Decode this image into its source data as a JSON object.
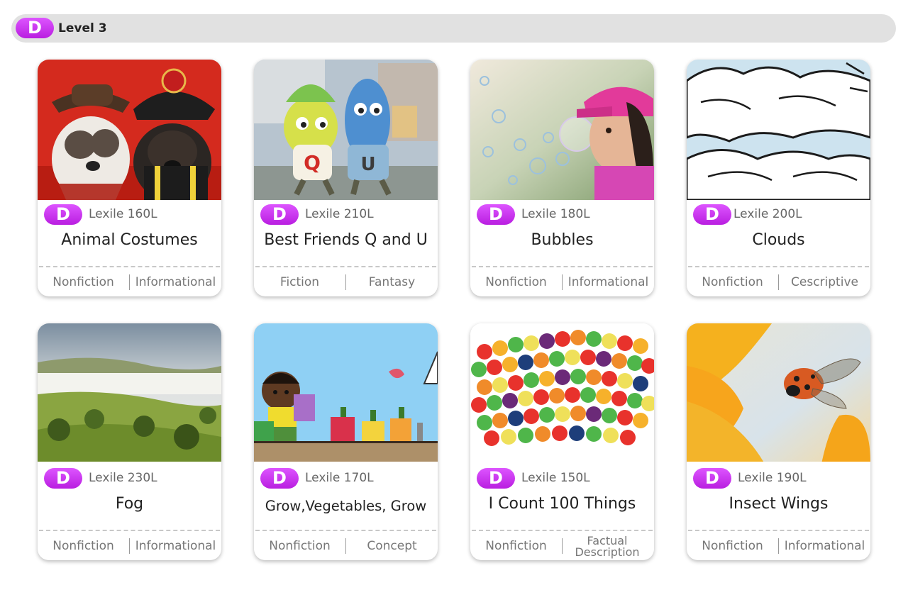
{
  "header": {
    "badge": "D",
    "label": "Level 3"
  },
  "books": [
    {
      "title": "Animal Costumes",
      "badge": "D",
      "lexile": "Lexile 160L",
      "tags": [
        "Nonfiction",
        "Informational"
      ]
    },
    {
      "title": "Best Friends Q and U",
      "badge": "D",
      "lexile": "Lexile 210L",
      "tags": [
        "Fiction",
        "Fantasy"
      ]
    },
    {
      "title": "Bubbles",
      "badge": "D",
      "lexile": "Lexile 180L",
      "tags": [
        "Nonfiction",
        "Informational"
      ]
    },
    {
      "title": "Clouds",
      "badge": "D",
      "lexile": "Lexile 200L",
      "tags": [
        "Nonfiction",
        "Cescriptive"
      ]
    },
    {
      "title": "Fog",
      "badge": "D",
      "lexile": "Lexile 230L",
      "tags": [
        "Nonfiction",
        "Informational"
      ]
    },
    {
      "title": "Grow,Vegetables, Grow",
      "badge": "D",
      "lexile": "Lexile 170L",
      "tags": [
        "Nonfiction",
        "Concept"
      ]
    },
    {
      "title": "I Count 100 Things",
      "badge": "D",
      "lexile": "Lexile 150L",
      "tags": [
        "Nonfiction",
        "Factual Description"
      ]
    },
    {
      "title": "Insect Wings",
      "badge": "D",
      "lexile": "Lexile 190L",
      "tags": [
        "Nonfiction",
        "Informational"
      ]
    }
  ]
}
